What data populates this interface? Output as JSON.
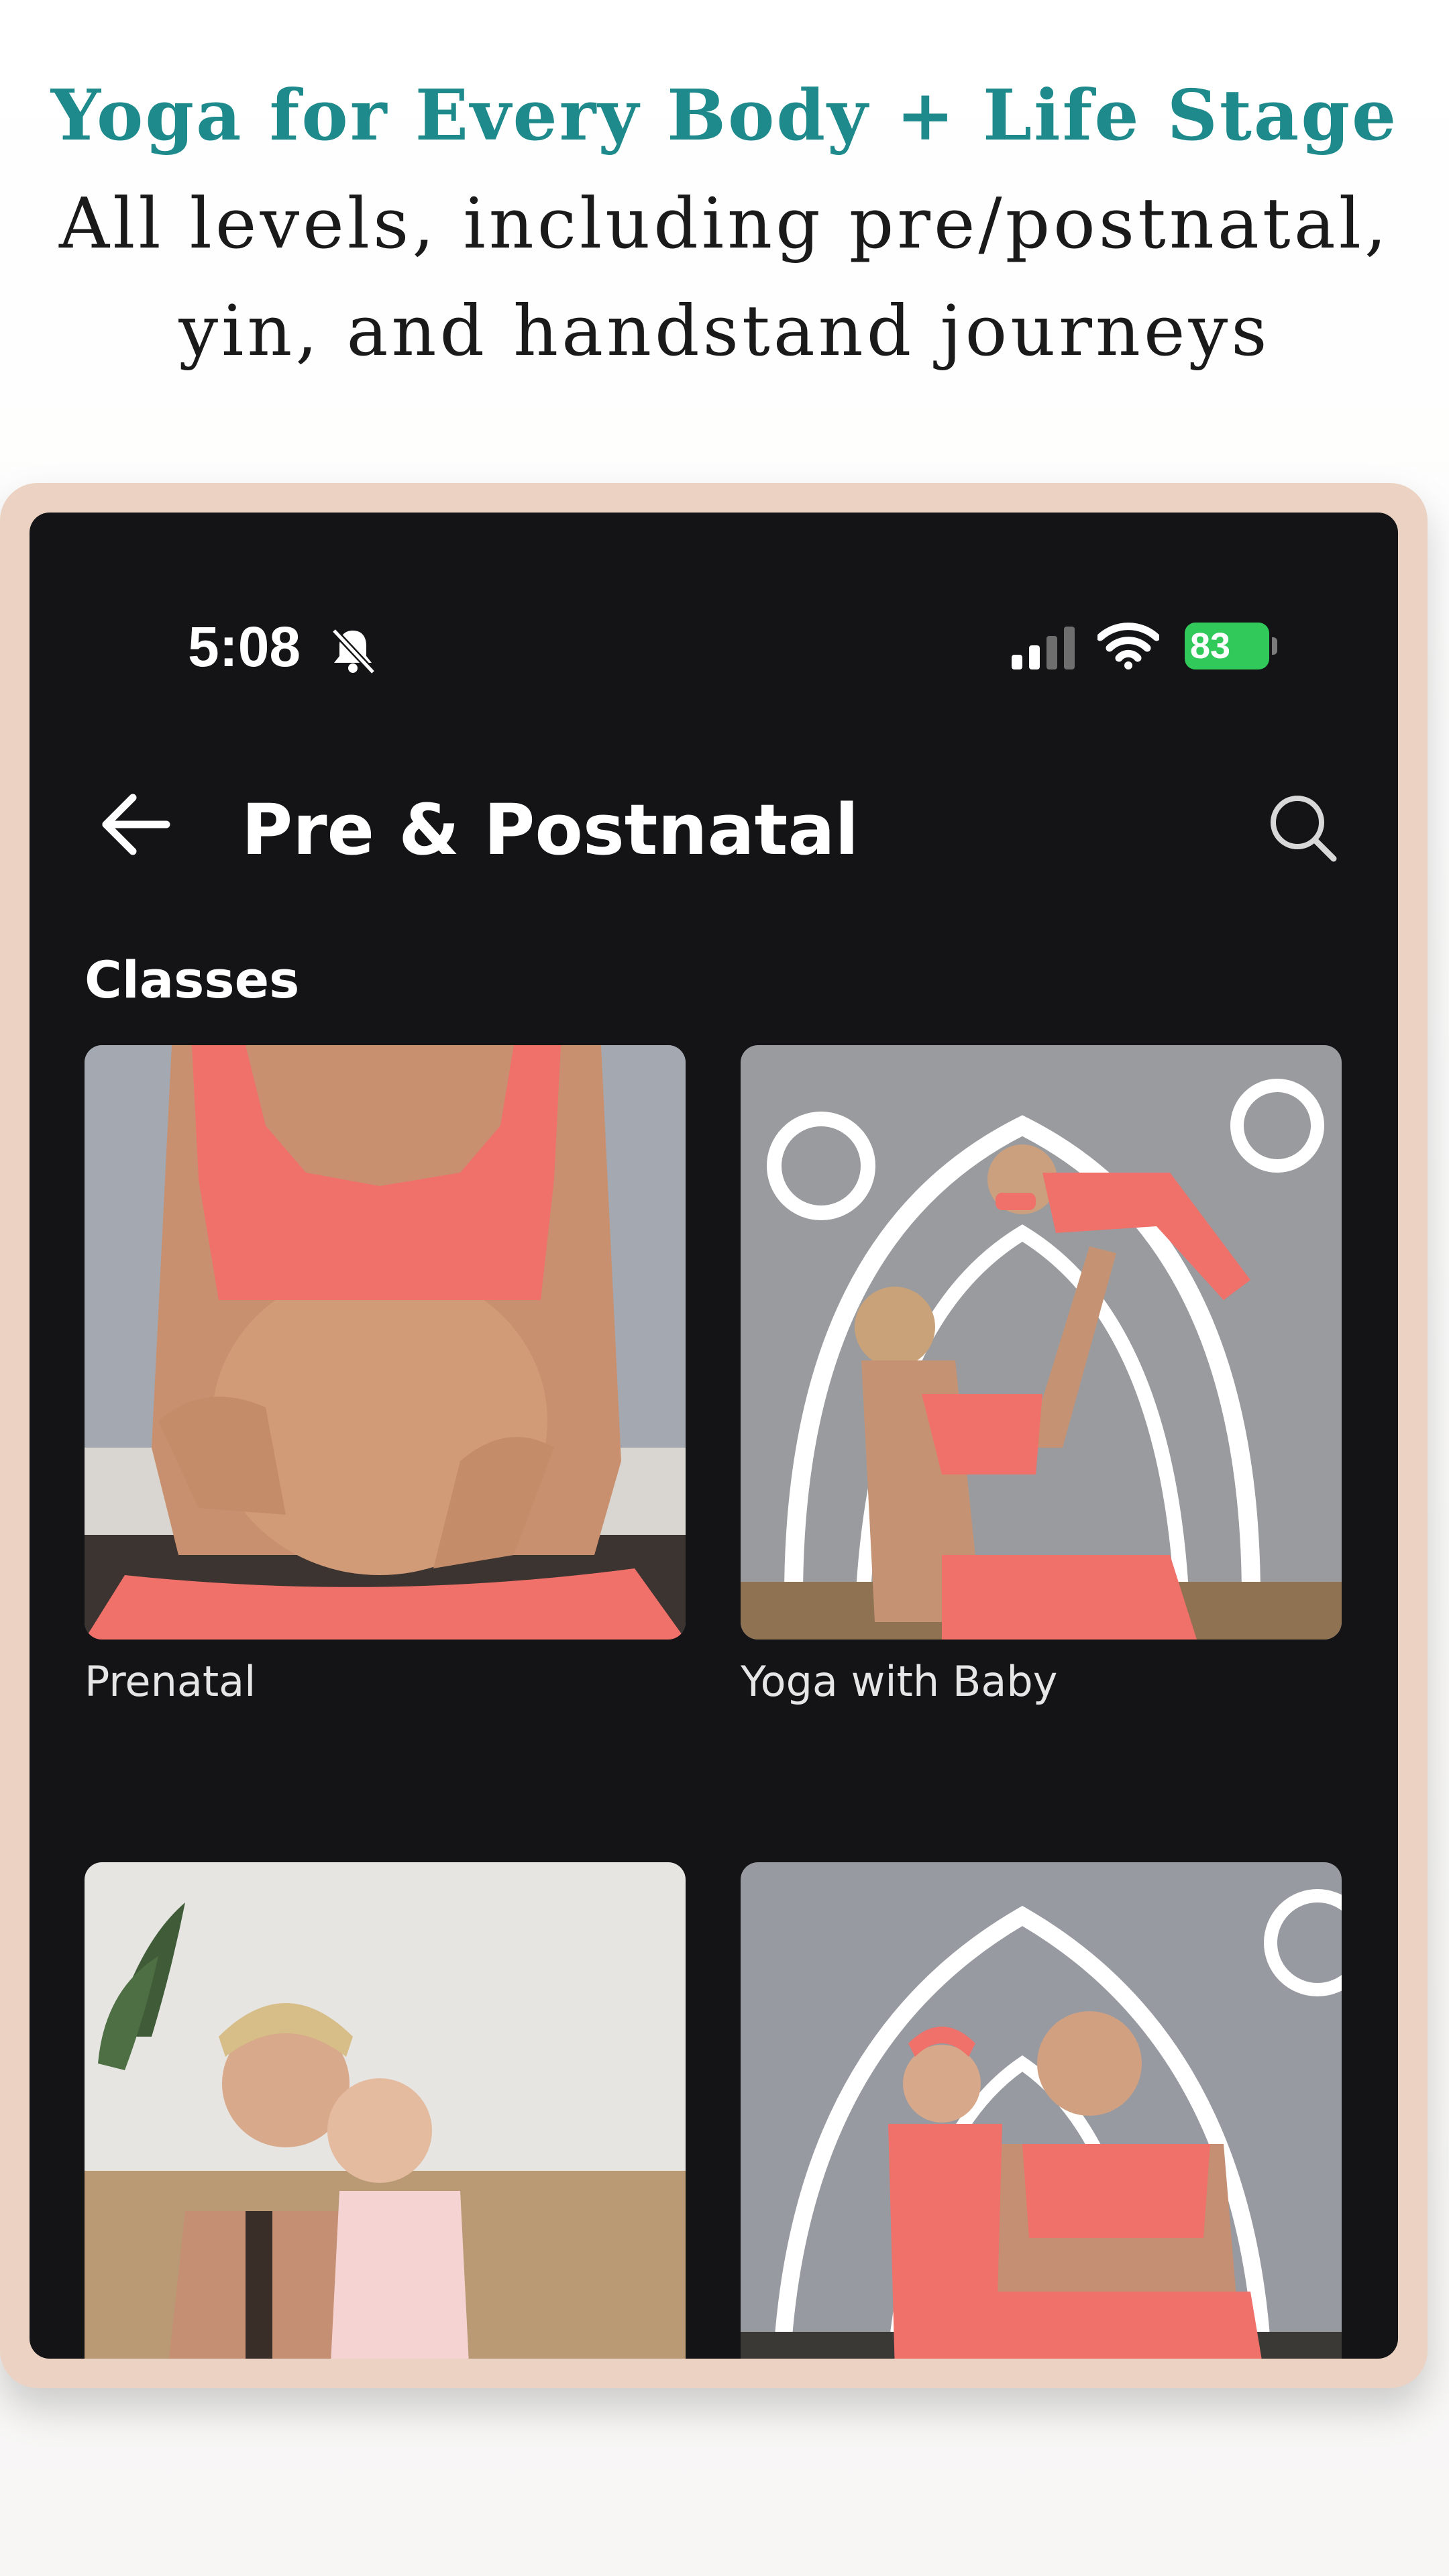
{
  "marketing": {
    "headline": "Yoga for Every Body + Life Stage",
    "subline_1": "All levels, including pre/postnatal,",
    "subline_2": "yin, and handstand journeys"
  },
  "status_bar": {
    "time": "5:08",
    "battery": "83"
  },
  "header": {
    "title": "Pre & Postnatal"
  },
  "section": {
    "title": "Classes"
  },
  "classes": [
    {
      "label": "Prenatal"
    },
    {
      "label": "Yoga with Baby"
    },
    {
      "label": ""
    },
    {
      "label": ""
    }
  ],
  "colors": {
    "headline_teal": "#1e8a8c",
    "frame_peach": "#ecd2c2",
    "screen_dark": "#141416",
    "battery_green": "#30c95a",
    "outfit_coral": "#f0706a"
  },
  "icons": [
    "bell-slash-icon",
    "signal-icon",
    "wifi-icon",
    "battery-icon",
    "back-arrow-icon",
    "search-icon"
  ]
}
